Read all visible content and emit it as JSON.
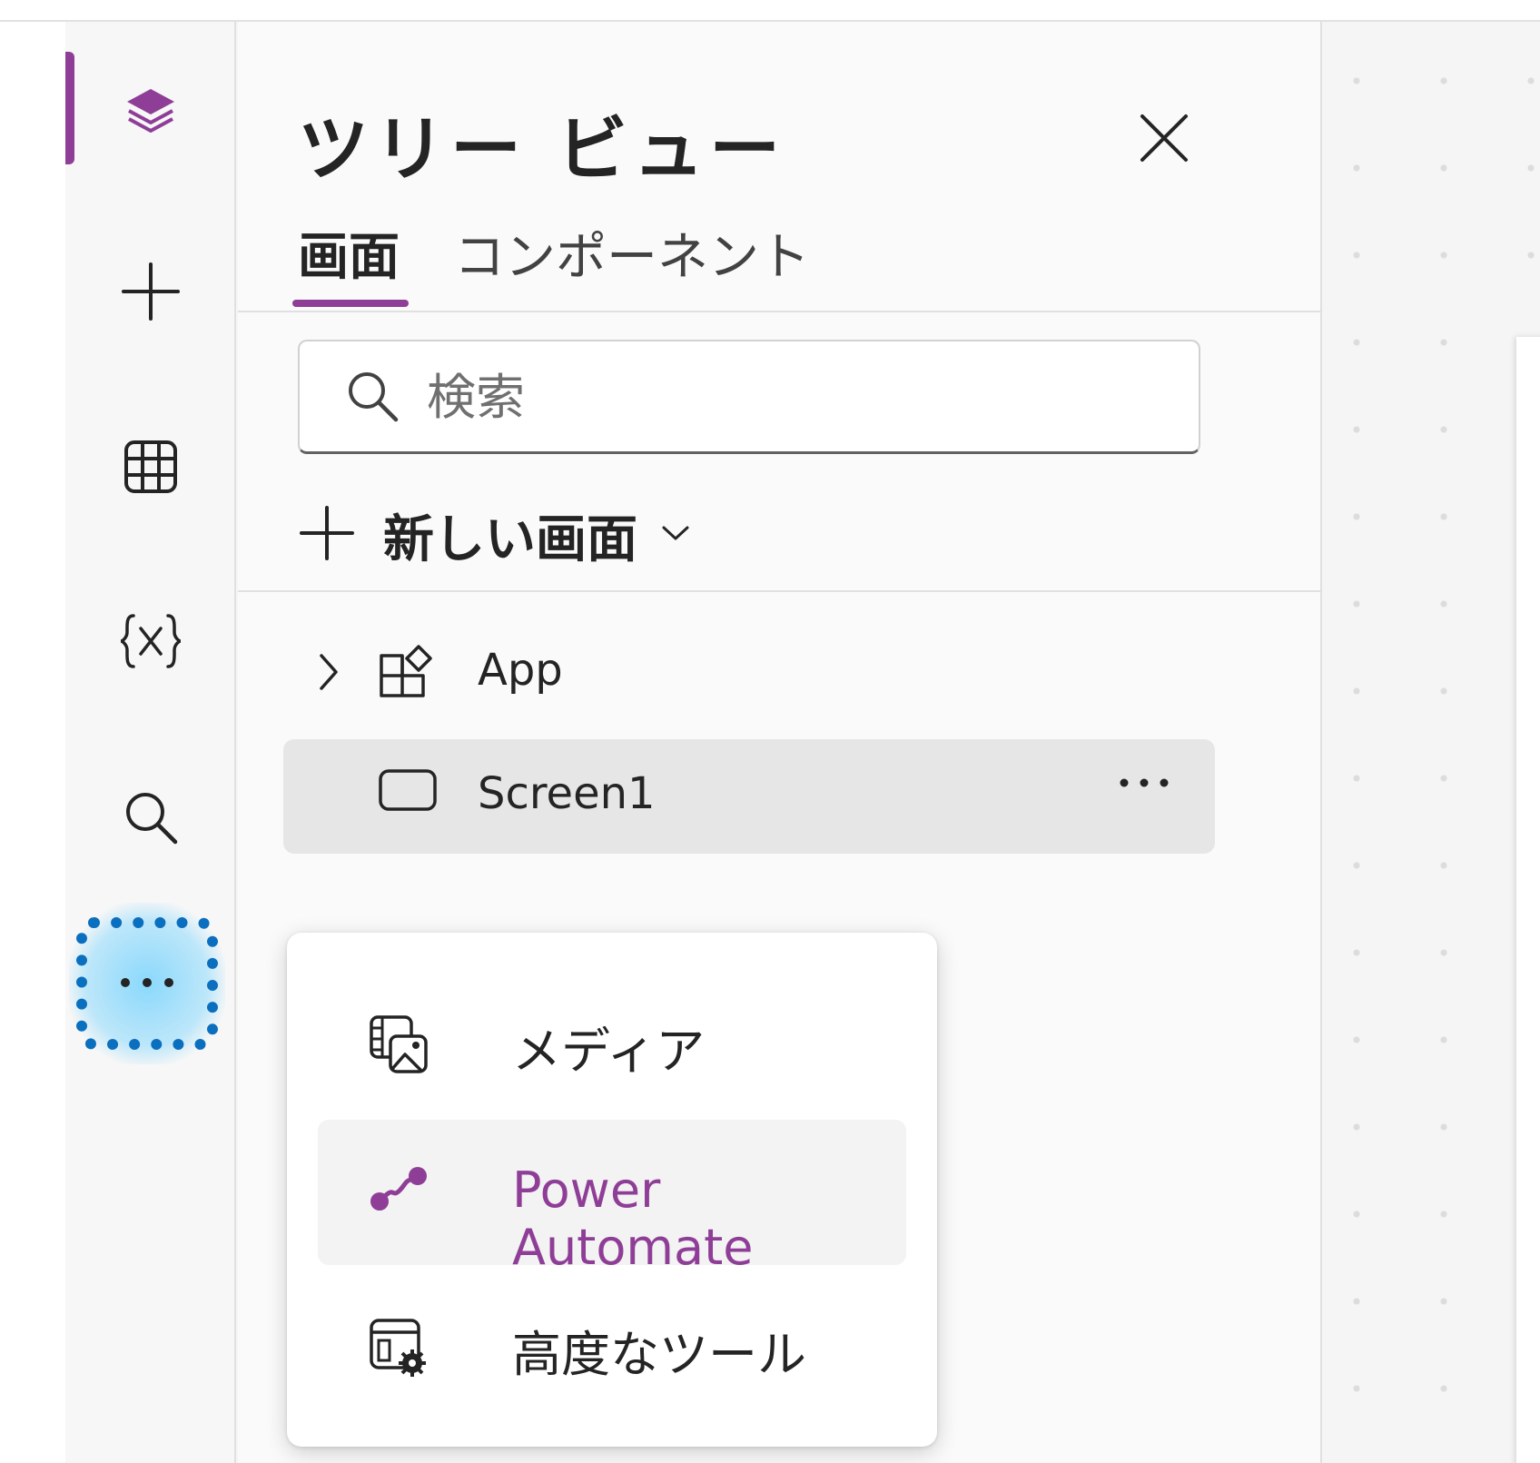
{
  "rail": {
    "items": [
      {
        "name": "tree-view",
        "icon": "layers-icon",
        "active": true
      },
      {
        "name": "insert",
        "icon": "plus-icon"
      },
      {
        "name": "data",
        "icon": "table-icon"
      },
      {
        "name": "variables",
        "icon": "variable-icon"
      },
      {
        "name": "search",
        "icon": "search-icon"
      },
      {
        "name": "more",
        "icon": "more-horizontal-icon",
        "focused": true
      }
    ]
  },
  "tree_panel": {
    "title": "ツリー ビュー",
    "tabs": [
      {
        "label": "画面",
        "selected": true
      },
      {
        "label": "コンポーネント",
        "selected": false
      }
    ],
    "search": {
      "placeholder": "検索",
      "value": ""
    },
    "new_screen_label": "新しい画面",
    "nodes": [
      {
        "label": "App",
        "icon": "app-icon",
        "expandable": true
      },
      {
        "label": "Screen1",
        "icon": "screen-icon",
        "selected": true
      }
    ]
  },
  "more_menu": {
    "items": [
      {
        "label": "メディア",
        "icon": "media-icon"
      },
      {
        "label": "Power Automate",
        "icon": "power-automate-icon",
        "highlighted": true
      },
      {
        "label": "高度なツール",
        "icon": "advanced-tools-icon"
      }
    ]
  },
  "colors": {
    "accent": "#8f3e97",
    "focus_ring": "#0b6fbf",
    "focus_glow": "#50c8ff",
    "selected_row": "#e6e6e6"
  }
}
